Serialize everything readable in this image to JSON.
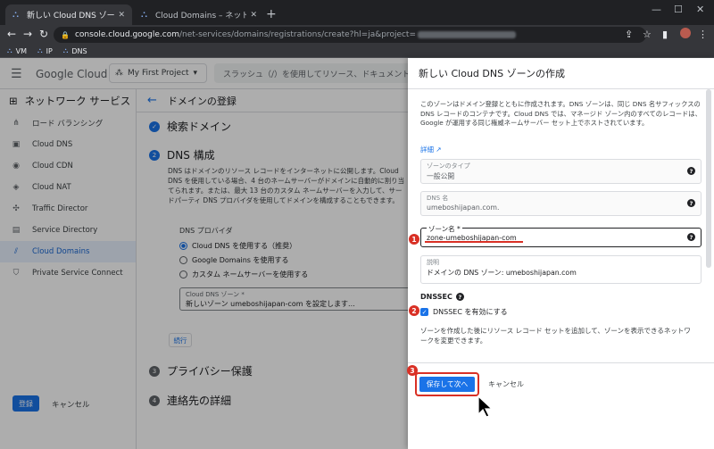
{
  "browser": {
    "tabs": [
      {
        "title": "新しい Cloud DNS ゾーンの作成 – ネ"
      },
      {
        "title": "Cloud Domains – ネットワーク サービ"
      }
    ],
    "url_host": "console.cloud.google.com",
    "url_path": "/net-services/domains/registrations/create?hl=ja&project=",
    "bookmarks": [
      "VM",
      "IP",
      "DNS"
    ]
  },
  "header": {
    "logo_google": "Google",
    "logo_cloud": " Cloud",
    "project": "My First Project",
    "search_placeholder": "スラッシュ（/）を使用してリソース、ドキュメント"
  },
  "leftnav": {
    "title": "ネットワーク サービス",
    "items": [
      {
        "label": "ロード バランシング",
        "icon": "load-balancer-icon"
      },
      {
        "label": "Cloud DNS",
        "icon": "dns-icon"
      },
      {
        "label": "Cloud CDN",
        "icon": "cdn-icon"
      },
      {
        "label": "Cloud NAT",
        "icon": "nat-icon"
      },
      {
        "label": "Traffic Director",
        "icon": "traffic-icon"
      },
      {
        "label": "Service Directory",
        "icon": "directory-icon"
      },
      {
        "label": "Cloud Domains",
        "icon": "domains-icon"
      },
      {
        "label": "Private Service Connect",
        "icon": "shield-icon"
      }
    ]
  },
  "main": {
    "title": "ドメインの登録",
    "step1": {
      "num": "✓",
      "label": "検索ドメイン"
    },
    "step2": {
      "num": "2",
      "label": "DNS 構成"
    },
    "description": "DNS はドメインのリソース レコードをインターネットに公開します。Cloud DNS を使用している場合、4 台のネームサーバーがドメインに自動的に割り当てられます。または、最大 13 台のカスタム ネームサーバーを入力して、サードパーティ DNS プロバイダを使用してドメインを構成することもできます。",
    "provider_heading": "DNS プロバイダ",
    "radio": [
      {
        "label": "Cloud DNS を使用する（推奨）",
        "checked": true
      },
      {
        "label": "Google Domains を使用する",
        "checked": false
      },
      {
        "label": "カスタム ネームサーバーを使用する",
        "checked": false
      }
    ],
    "select_label": "Cloud DNS ゾーン *",
    "select_value": "新しいゾーン umeboshijapan-com を設定します...",
    "continue_label": "続行",
    "step3": {
      "num": "3",
      "label": "プライバシー保護"
    },
    "step4": {
      "num": "4",
      "label": "連絡先の詳細"
    },
    "register_label": "登録",
    "cancel_label": "キャンセル"
  },
  "panel": {
    "title": "新しい Cloud DNS ゾーンの作成",
    "description": "このゾーンはドメイン登録とともに作成されます。DNS ゾーンは、同じ DNS 名サフィックスの DNS レコードのコンテナです。Cloud DNS では、マネージド ゾーン内のすべてのレコードは、Google が運用する同じ権威ネームサーバー セット上でホストされています。",
    "link": "詳細 ↗",
    "zone_type_label": "ゾーンのタイプ",
    "zone_type_value": "一般公開",
    "dns_name_label": "DNS 名",
    "dns_name_value": "umeboshijapan.com.",
    "zone_name_label": "ゾーン名 *",
    "zone_name_value": "zone-umeboshijapan-com",
    "desc_label": "説明",
    "desc_value": "ドメインの DNS ゾーン: umeboshijapan.com",
    "dnssec_heading": "DNSSEC",
    "dnssec_checkbox": "DNSSEC を有効にする",
    "note": "ゾーンを作成した後にリソース レコード セットを追加して、ゾーンを表示できるネットワークを変更できます。",
    "save_label": "保存して次へ",
    "cancel_label": "キャンセル"
  },
  "markers": [
    "1",
    "2",
    "3"
  ],
  "colors": {
    "accent": "#1a73e8",
    "highlight": "#d93025"
  }
}
